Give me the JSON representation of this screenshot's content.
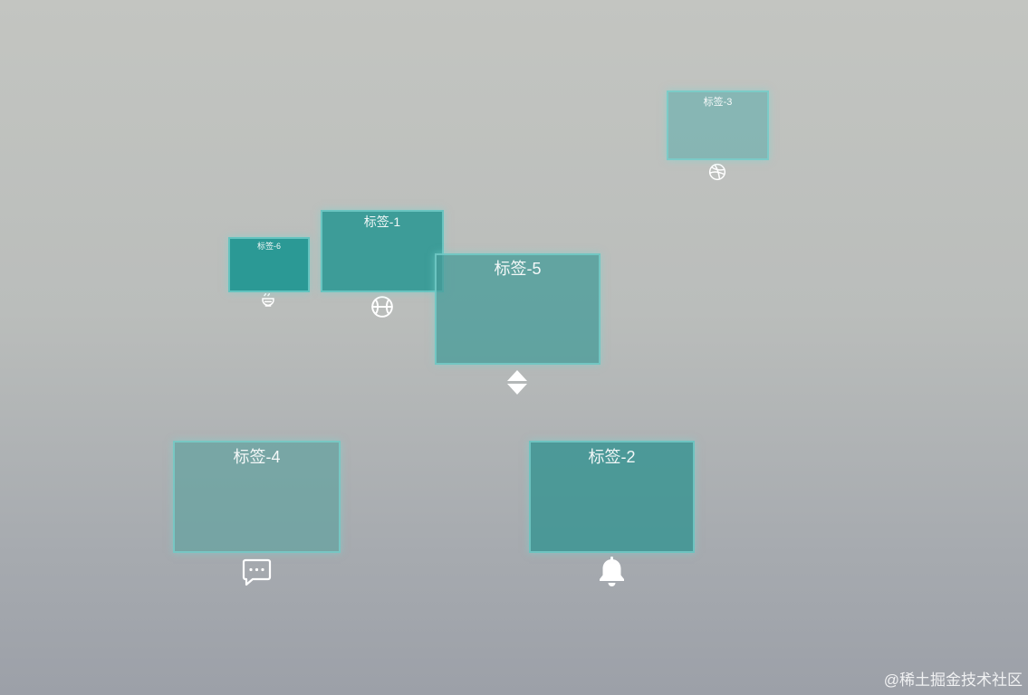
{
  "tags": [
    {
      "id": "tag-3",
      "label": "标签-3",
      "icon": "dribbble-ball-icon"
    },
    {
      "id": "tag-6",
      "label": "标签-6",
      "icon": "bowl-icon"
    },
    {
      "id": "tag-1",
      "label": "标签-1",
      "icon": "baseball-icon"
    },
    {
      "id": "tag-5",
      "label": "标签-5",
      "icon": "sort-updown-icon"
    },
    {
      "id": "tag-4",
      "label": "标签-4",
      "icon": "chat-message-icon"
    },
    {
      "id": "tag-2",
      "label": "标签-2",
      "icon": "bell-icon"
    }
  ],
  "watermark": "@稀土掘金技术社区",
  "colors": {
    "card_teal": "#17948f",
    "card_border_glow": "#78d2cd",
    "background_top": "#c3c5c1",
    "background_bottom": "#9ca0a8",
    "icon": "#ffffff"
  }
}
